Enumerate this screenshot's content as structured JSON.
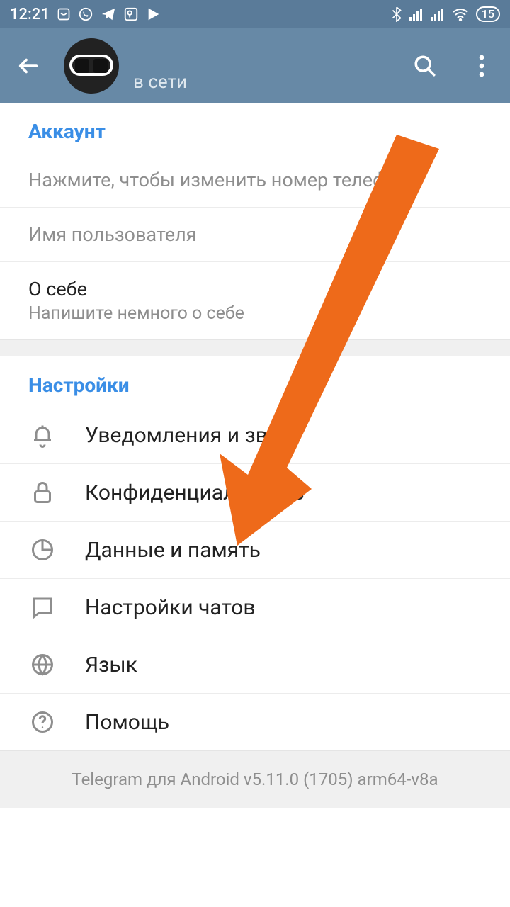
{
  "status": {
    "time": "12:21",
    "battery": "15"
  },
  "header": {
    "status_text": "в сети"
  },
  "account": {
    "section_title": "Аккаунт",
    "phone_hint": "Нажмите, чтобы изменить номер телефона",
    "username_label": "Имя пользователя",
    "about_title": "О себе",
    "about_hint": "Напишите немного о себе"
  },
  "settings": {
    "section_title": "Настройки",
    "items": {
      "notifications": "Уведомления и звук",
      "privacy": "Конфиденциальность",
      "data": "Данные и память",
      "chats": "Настройки чатов",
      "language": "Язык",
      "help": "Помощь"
    }
  },
  "footer": {
    "version": "Telegram для Android v5.11.0 (1705) arm64-v8a"
  }
}
